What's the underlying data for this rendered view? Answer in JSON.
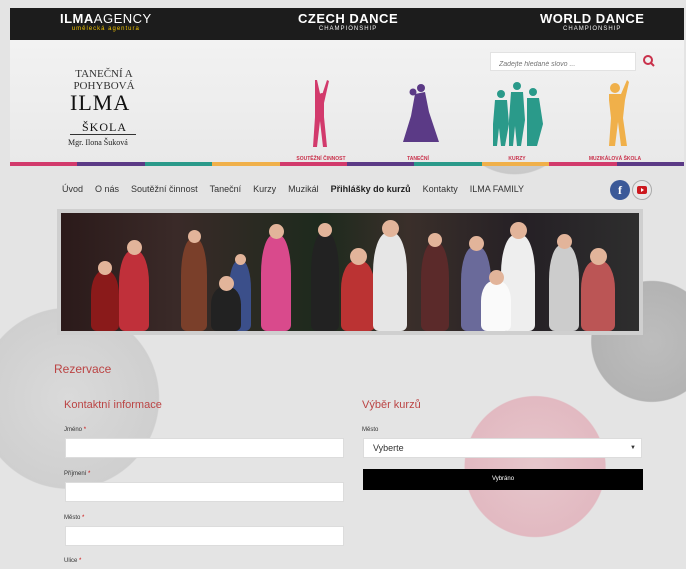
{
  "top_brands": {
    "ilma": {
      "main_bold": "ILMA",
      "main_light": "AGENCY",
      "sub": "umělecká agentura"
    },
    "czech": {
      "main": "CZECH DANCE",
      "sub": "CHAMPIONSHIP"
    },
    "world": {
      "main": "WORLD DANCE",
      "sub": "CHAMPIONSHIP"
    }
  },
  "logo": {
    "arc_text": "TANEČNÍ A POHYBOVÁ",
    "big": "ILMA",
    "skola": "ŠKOLA",
    "teacher": "Mgr. Ilona Šuková"
  },
  "search": {
    "placeholder": "Zadejte hledané slovo ..."
  },
  "categories": [
    {
      "label": "SOUTĚŽNÍ ČINNOST",
      "color": "#d23a6c"
    },
    {
      "label": "TANEČNÍ",
      "color": "#5b3a86"
    },
    {
      "label": "KURZY",
      "color": "#2a9a8a"
    },
    {
      "label": "MUZIKÁLOVÁ ŠKOLA",
      "color": "#f0b04a"
    }
  ],
  "stripe_colors": [
    "#d23a6c",
    "#5b3a86",
    "#2a9a8a",
    "#f0b04a",
    "#d23a6c",
    "#5b3a86",
    "#2a9a8a",
    "#f0b04a",
    "#d23a6c",
    "#5b3a86"
  ],
  "nav": [
    {
      "label": "Úvod"
    },
    {
      "label": "O nás"
    },
    {
      "label": "Soutěžní činnost"
    },
    {
      "label": "Taneční"
    },
    {
      "label": "Kurzy"
    },
    {
      "label": "Muzikál"
    },
    {
      "label": "Přihlášky do kurzů",
      "active": true
    },
    {
      "label": "Kontakty"
    },
    {
      "label": "ILMA FAMILY"
    }
  ],
  "social": {
    "facebook": "f"
  },
  "form": {
    "title": "Rezervace",
    "contact_title": "Kontaktní informace",
    "course_title": "Výběr kurzů",
    "fields": [
      {
        "label": "Jméno",
        "required": "*"
      },
      {
        "label": "Příjmení",
        "required": "*"
      },
      {
        "label": "Město",
        "required": "*"
      },
      {
        "label": "Ulice",
        "required": "*"
      }
    ],
    "city_label": "Město",
    "city_value": "Vyberte",
    "select_button": "Vybráno"
  }
}
